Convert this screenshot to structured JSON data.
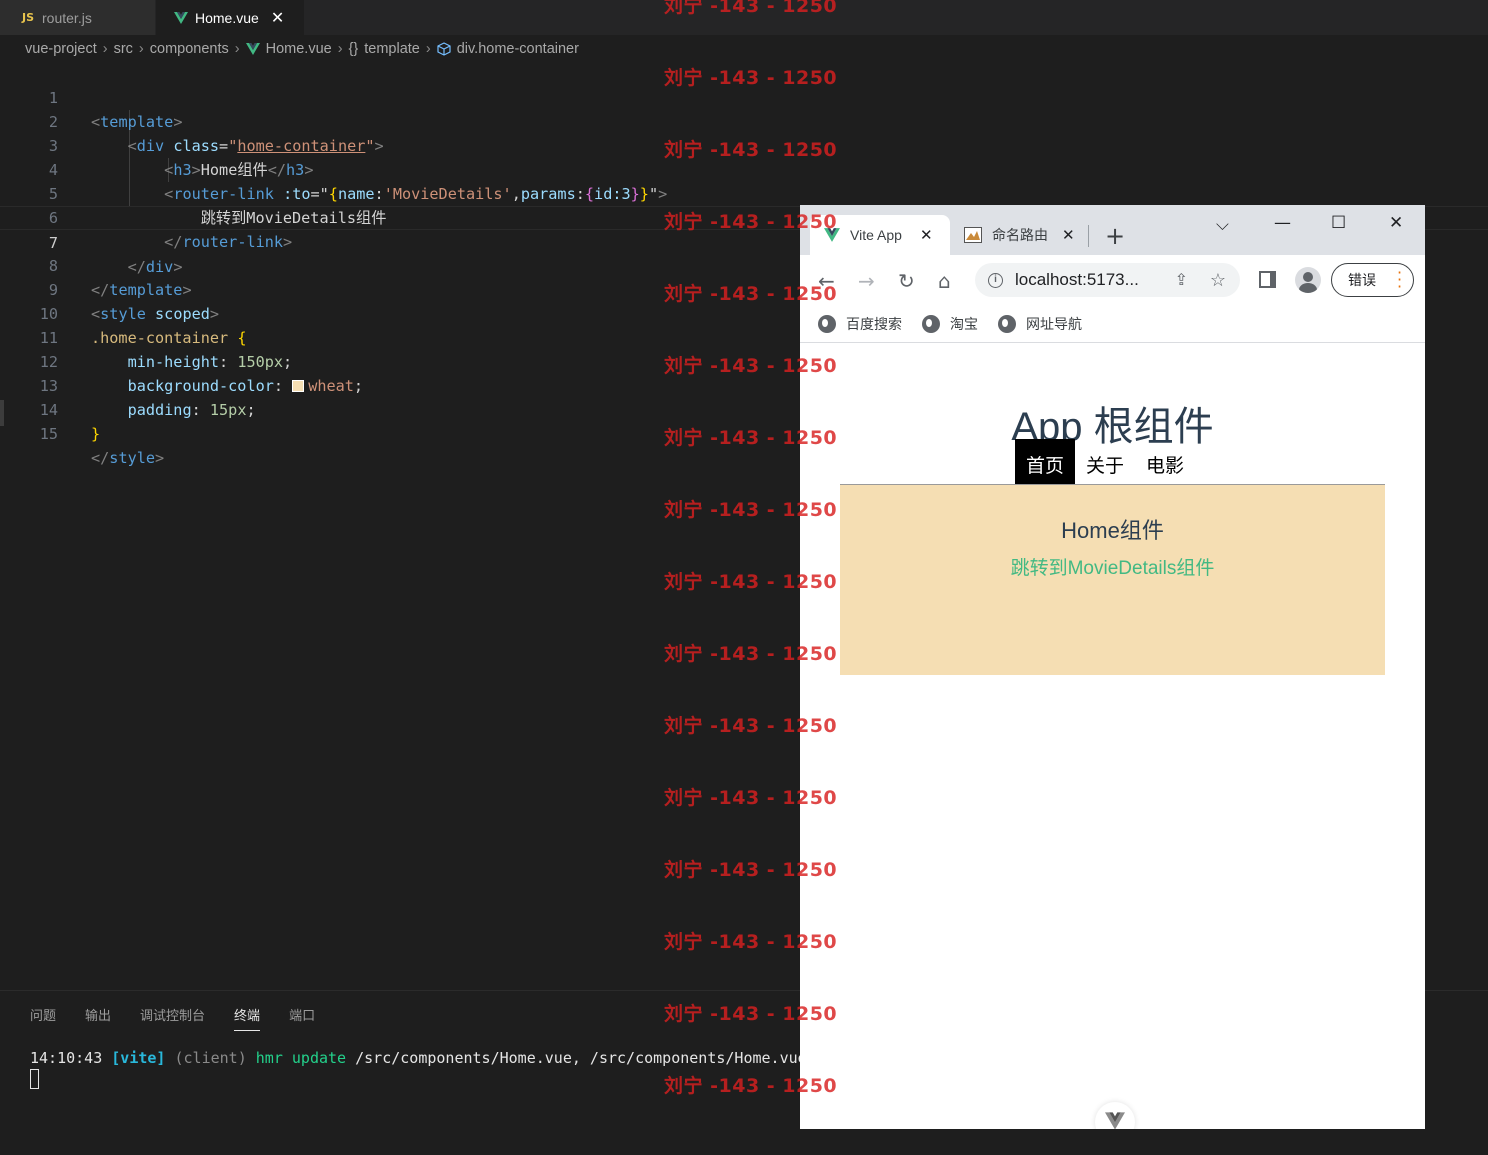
{
  "editor": {
    "tabs": [
      {
        "label": "router.js",
        "badge": "JS"
      },
      {
        "label": "Home.vue"
      }
    ],
    "breadcrumb": [
      "vue-project",
      "src",
      "components",
      "Home.vue",
      "template",
      "div.home-container"
    ],
    "line_numbers": [
      "1",
      "2",
      "3",
      "4",
      "5",
      "6",
      "7",
      "8",
      "9",
      "10",
      "11",
      "12",
      "13",
      "14",
      "15"
    ],
    "code": {
      "l1": {
        "tag": "template"
      },
      "l2": {
        "tag": "div",
        "attr": "class",
        "value": "home-container"
      },
      "l3": {
        "tag": "h3",
        "text": "Home组件"
      },
      "l4": {
        "tag": "router-link",
        "attr": ":to",
        "key1": "name",
        "val1": "'MovieDetails'",
        "key2": "params",
        "inner": "id:3"
      },
      "l5": {
        "text": "跳转到MovieDetails组件"
      },
      "l6": {
        "tag": "router-link"
      },
      "l7": {
        "tag": "div"
      },
      "l8": {
        "tag": "template"
      },
      "l9": {
        "tag": "style",
        "attr": "scoped"
      },
      "l10": {
        "selector": ".home-container"
      },
      "l11": {
        "prop": "min-height",
        "value": "150px"
      },
      "l12": {
        "prop": "background-color",
        "value": "wheat",
        "swatch_color": "#f5deb3"
      },
      "l13": {
        "prop": "padding",
        "value": "15px"
      }
    }
  },
  "panel": {
    "tabs": [
      "问题",
      "输出",
      "调试控制台",
      "终端",
      "端口"
    ],
    "active_tab": "终端",
    "terminal": {
      "time": "14:10:43",
      "tag": "[vite]",
      "client": "(client)",
      "action": "hmr update",
      "paths": "/src/components/Home.vue, /src/components/Home.vue"
    }
  },
  "browser": {
    "tabs": [
      {
        "title": "Vite App"
      },
      {
        "title": "命名路由"
      }
    ],
    "address": "localhost:5173...",
    "error_button": "错误",
    "bookmarks": [
      "百度搜索",
      "淘宝",
      "网址导航"
    ],
    "page": {
      "title": "App 根组件",
      "nav": [
        "首页",
        "关于",
        "电影"
      ],
      "active_nav": "首页",
      "home_heading": "Home组件",
      "home_link": "跳转到MovieDetails组件"
    }
  },
  "watermark": "刘宁 -143 - 1250"
}
